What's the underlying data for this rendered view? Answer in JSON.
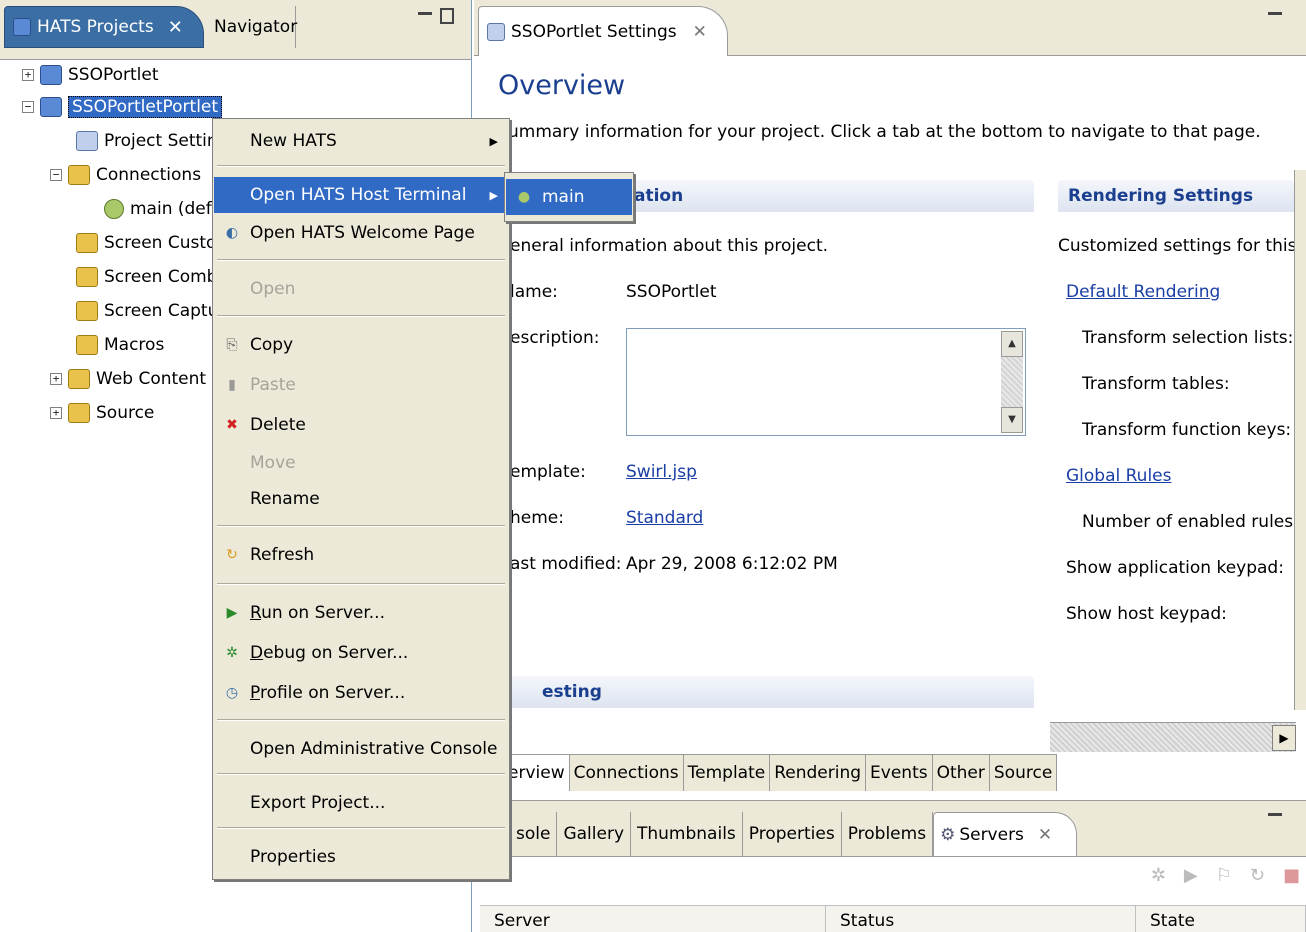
{
  "left_view": {
    "active_tab": "HATS Projects",
    "inactive_tab": "Navigator",
    "tree": [
      {
        "label": "SSOPortlet"
      },
      {
        "label": "SSOPortletPortlet"
      },
      {
        "label": "Project Setting"
      },
      {
        "label": "Connections"
      },
      {
        "label": "main (defa"
      },
      {
        "label": "Screen Custor"
      },
      {
        "label": "Screen Combir"
      },
      {
        "label": "Screen Captur"
      },
      {
        "label": "Macros"
      },
      {
        "label": "Web Content"
      },
      {
        "label": "Source"
      }
    ]
  },
  "editor": {
    "tab_label": "SSOPortlet Settings",
    "title": "Overview",
    "summary": "ummary information for your project. Click a tab at the bottom to navigate to that page.",
    "general_section_title": "ation",
    "general_description": "eneral information about this project.",
    "fields": {
      "name_label": "lame:",
      "name_value": "SSOPortlet",
      "description_label": "escription:",
      "template_label": "emplate:",
      "template_value": "Swirl.jsp",
      "theme_label": "heme:",
      "theme_value": "Standard",
      "modified_label": "ast modified:",
      "modified_value": "Apr 29, 2008 6:12:02 PM"
    },
    "testing_section_title": "esting",
    "rendering": {
      "title": "Rendering Settings",
      "description": "Customized settings for this prc",
      "default_rendering_link": "Default Rendering",
      "transform_selection": "Transform selection lists:",
      "transform_tables": "Transform tables:",
      "transform_function_keys": "Transform function keys:",
      "global_rules_link": "Global Rules",
      "enabled_rules": "Number of enabled rules:",
      "show_app_keypad": "Show application keypad:",
      "show_host_keypad": "Show host keypad:"
    },
    "page_tabs": [
      "erview",
      "Connections",
      "Template",
      "Rendering",
      "Events",
      "Other",
      "Source"
    ]
  },
  "bottom_panel": {
    "tabs": [
      "sole",
      "Gallery",
      "Thumbnails",
      "Properties",
      "Problems",
      "Servers"
    ],
    "active_tab": "Servers",
    "columns": [
      "Server",
      "Status",
      "State"
    ]
  },
  "context_menu": {
    "items": {
      "new_hats": "New HATS",
      "open_terminal": "Open HATS Host Terminal",
      "welcome": "Open HATS Welcome Page",
      "open": "Open",
      "copy": "Copy",
      "paste": "Paste",
      "delete": "Delete",
      "move": "Move",
      "rename": "Rename",
      "refresh": "Refresh",
      "run": "Run on Server...",
      "debug": "Debug on Server...",
      "profile": "Profile on Server...",
      "admin_console": "Open Administrative Console",
      "export": "Export Project...",
      "properties": "Properties"
    },
    "submenu_item": "main"
  },
  "colors": {
    "selection": "#316ac5",
    "menu_bg": "#ece9d8",
    "heading": "#1b3f8f",
    "link": "#1a3ea6"
  }
}
